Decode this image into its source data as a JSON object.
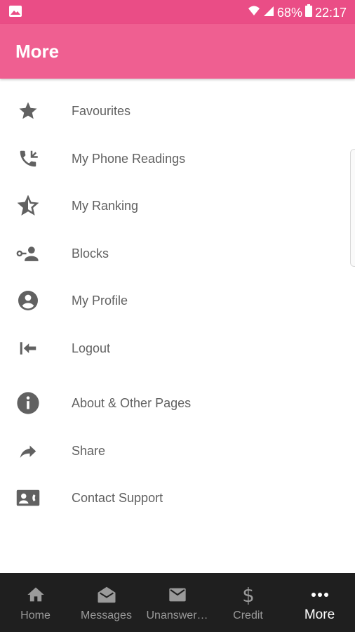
{
  "status_bar": {
    "battery": "68%",
    "time": "22:17"
  },
  "app_bar": {
    "title": "More"
  },
  "menu": {
    "items": [
      {
        "label": "Favourites",
        "icon": "star-icon"
      },
      {
        "label": "My Phone Readings",
        "icon": "phone-callback-icon"
      },
      {
        "label": "My Ranking",
        "icon": "star-half-icon"
      },
      {
        "label": "Blocks",
        "icon": "block-user-icon"
      },
      {
        "label": "My Profile",
        "icon": "account-circle-icon"
      },
      {
        "label": "Logout",
        "icon": "logout-icon"
      },
      {
        "label": "About & Other Pages",
        "icon": "info-icon"
      },
      {
        "label": "Share",
        "icon": "share-arrow-icon"
      },
      {
        "label": "Contact Support",
        "icon": "contact-card-icon"
      }
    ]
  },
  "bottom_nav": {
    "tabs": [
      {
        "label": "Home",
        "icon": "home-icon"
      },
      {
        "label": "Messages",
        "icon": "drafts-icon"
      },
      {
        "label": "Unanswer…",
        "icon": "mail-icon"
      },
      {
        "label": "Credit",
        "icon": "dollar-icon"
      },
      {
        "label": "More",
        "icon": "more-dots-icon",
        "active": true
      }
    ]
  },
  "colors": {
    "status_bar": "#ea4d86",
    "app_bar": "#ef5f91",
    "icon_gray": "#616161",
    "nav_background": "#1f1f1f"
  }
}
